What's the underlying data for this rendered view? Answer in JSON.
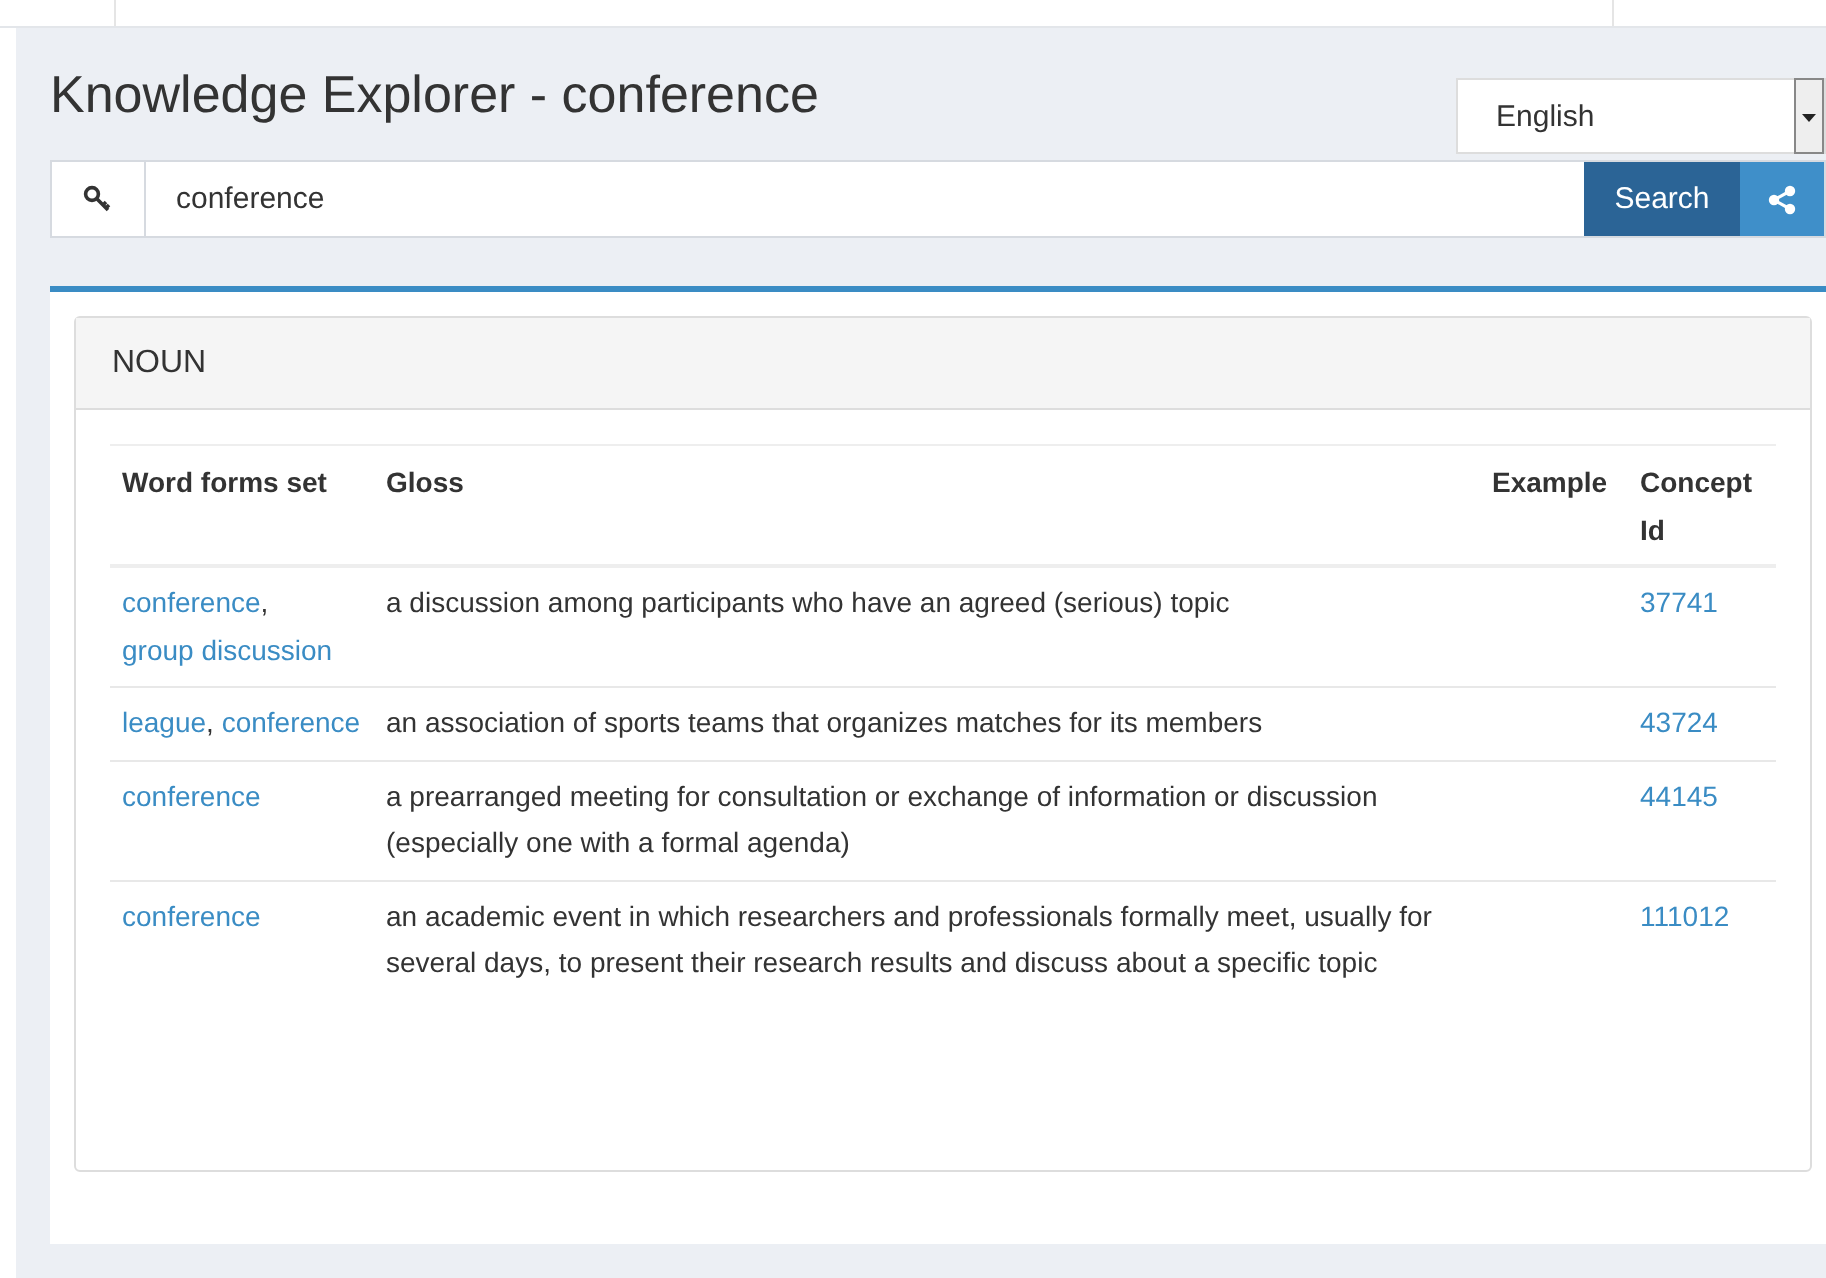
{
  "page": {
    "title": "Knowledge Explorer - conference"
  },
  "language_select": {
    "value": "English"
  },
  "search": {
    "value": "conference",
    "button": "Search"
  },
  "panel": {
    "heading": "NOUN"
  },
  "table": {
    "columns": [
      "Word forms set",
      "Gloss",
      "Example",
      "Concept Id"
    ],
    "rows": [
      {
        "word_forms": [
          {
            "word": "conference",
            "separator": ","
          },
          {
            "word": "group discussion"
          }
        ],
        "gloss": "a discussion among participants who have an agreed (serious) topic",
        "concept_id": "37741"
      },
      {
        "word_forms": [
          {
            "word": "league",
            "separator": ","
          },
          {
            "word": "conference"
          }
        ],
        "gloss": "an association of sports teams that organizes matches for its members",
        "concept_id": "43724"
      },
      {
        "word_forms": [
          {
            "word": "conference"
          }
        ],
        "gloss": "a prearranged meeting for consultation or exchange of information or discussion (especially one with a formal agenda)",
        "concept_id": "44145"
      },
      {
        "word_forms": [
          {
            "word": "conference"
          }
        ],
        "gloss": "an academic event in which researchers and professionals formally meet, usually for several days, to present their research results and discuss about a specific topic",
        "concept_id": "111012"
      }
    ]
  }
}
